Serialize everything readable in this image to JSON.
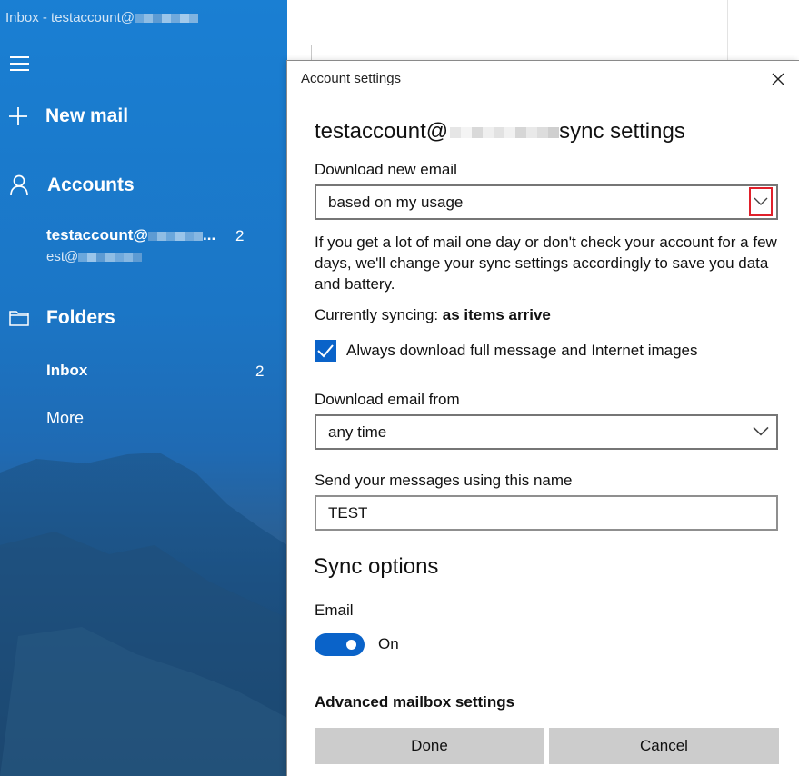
{
  "window": {
    "title_prefix": "Inbox - testaccount@"
  },
  "sidebar": {
    "new_mail_label": "New mail",
    "accounts_label": "Accounts",
    "account": {
      "name_visible": "testaccount@",
      "name_suffix": "...",
      "email_prefix": "est@",
      "unread_count": "2"
    },
    "folders_label": "Folders",
    "folders": [
      {
        "label": "Inbox",
        "count": "2"
      }
    ],
    "more_label": "More"
  },
  "dialog": {
    "title": "Account settings",
    "heading_prefix": "testaccount@",
    "heading_suffix": " sync settings",
    "download_new_email": {
      "label": "Download new email",
      "selected": "based on my usage"
    },
    "info_text": "If you get a lot of mail one day or don't check your account for a few days, we'll change your sync settings accordingly to save you data and battery.",
    "currently_syncing": {
      "label": "Currently syncing: ",
      "value": "as items arrive"
    },
    "full_message_checkbox": {
      "label": "Always download full message and Internet images",
      "checked": true
    },
    "download_email_from": {
      "label": "Download email from",
      "selected": "any time"
    },
    "send_name": {
      "label": "Send your messages using this name",
      "value": "TEST"
    },
    "sync_options": {
      "heading": "Sync options",
      "email_label": "Email",
      "email_toggle_state": "On"
    },
    "advanced_link": "Advanced mailbox settings",
    "done_label": "Done",
    "cancel_label": "Cancel"
  },
  "colors": {
    "accent": "#0a63c9",
    "sidebar_blue": "#1a7fd3",
    "highlight_red": "#e0202a",
    "button_gray": "#cccccc"
  }
}
